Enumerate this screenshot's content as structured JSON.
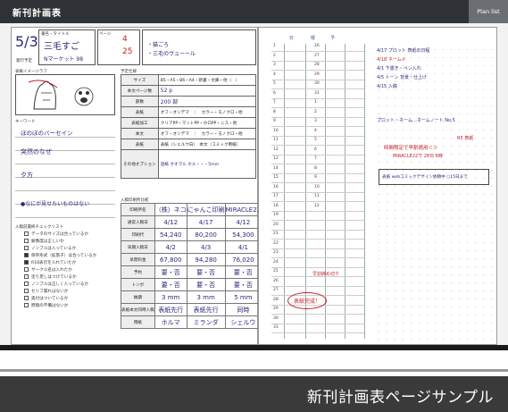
{
  "header": {
    "title": "新刊計画表",
    "tab": "Plan list"
  },
  "caption": "新刊計画表ページサンプル",
  "left_page": {
    "date": "5/3",
    "date_note": "発行予定",
    "title_label": "書名・タイトル",
    "title_value": "三毛すご",
    "pages_label": "ページ",
    "pages_value": "4",
    "pages_value2": "25",
    "shop_label": "Nマーケット 98",
    "memo_items": [
      "・猫ごろ",
      "・三毛のヴューール"
    ],
    "image_label": "表紙イメージラフ",
    "keyword_label": "キーワード",
    "keywords": [
      "ほのぼのバーセイン",
      "突然のなぜ",
      "夕方",
      "●なにが見せたいものはない"
    ],
    "checklist_label": "入稿前最終チェックリスト",
    "checklist": [
      "データのサイズは合っているか",
      "解像度は正しいか",
      "ノンブルは入っているか",
      "保存形式（拡張子）は合っているか",
      "R18表示を入れていたか",
      "サークル名は入れたか",
      "塗り足しはつけているか",
      "ノンブルは正しく入っているか",
      "セリフ漏れはないか",
      "奥付はついているか",
      "原稿の不備はないか"
    ],
    "spec_label": "予定仕様",
    "spec_rows": [
      {
        "h": "サイズ",
        "v": "B5・A5・B6・A4・新書・文庫・他（　）"
      },
      {
        "h": "本文ページ数",
        "v": "52 p"
      },
      {
        "h": "部数",
        "v": "200 部"
      },
      {
        "h": "表紙",
        "v": "オフ・オンデマ　｜　カラー・モノクロ・他"
      },
      {
        "h": "表紙加工",
        "v": "クリアPP・マットPP・ホロPP・ニス・他"
      },
      {
        "h": "本文",
        "v": "オフ・オンデマ　｜　カラー・モノクロ・他"
      },
      {
        "h": "表紙",
        "v": "表紙（シェルウ白）　本文（コミック用紙）"
      },
      {
        "h": "その他オプション",
        "v": "遊紙 オオマル ホル・・・5mm"
      }
    ],
    "compare_label": "入稿印刷所比較",
    "printers": [
      "（株）ネコ",
      "にゃんこ印刷",
      "MIRACLE22"
    ],
    "compare_rows": [
      {
        "h": "印刷所名",
        "v": [
          "（株）ネコ",
          "にゃんこ印刷",
          "MIRACLE22"
        ]
      },
      {
        "h": "通常入稿日",
        "v": [
          "4/12",
          "4/17",
          "4/12"
        ]
      },
      {
        "h": "印刷代",
        "v": [
          "54,240",
          "80,200",
          "54,300"
        ]
      },
      {
        "h": "早期入稿日",
        "v": [
          "4/2",
          "4/3",
          "4/1"
        ]
      },
      {
        "h": "早割料金",
        "v": [
          "67,800",
          "94,280",
          "76,020"
        ]
      },
      {
        "h": "予約",
        "v": [
          "要・否",
          "要・否",
          "要・否"
        ]
      },
      {
        "h": "トンボ",
        "v": [
          "要・否",
          "要・否",
          "要・否"
        ]
      },
      {
        "h": "納期",
        "v": [
          "3 mm",
          "3 mm",
          "5 mm"
        ]
      },
      {
        "h": "表紙本文同時入稿",
        "v": [
          "表紙先行",
          "表紙先行",
          "同時"
        ]
      },
      {
        "h": "用紙",
        "v": [
          "ホルマ",
          "ミランダ",
          "シェルウ"
        ]
      }
    ]
  },
  "right_page": {
    "col_headers": [
      "日",
      "曜",
      "予"
    ],
    "days": [
      "1",
      "2",
      "3",
      "4",
      "5",
      "6",
      "7",
      "8",
      "9",
      "10",
      "11",
      "12",
      "13",
      "14",
      "15",
      "16",
      "17",
      "18",
      "19",
      "20",
      "21",
      "22",
      "23",
      "24",
      "25",
      "26",
      "27",
      "28",
      "29",
      "30",
      "31"
    ],
    "second_col": [
      "26",
      "27",
      "28",
      "29",
      "30",
      "31",
      "1",
      "2",
      "3",
      "4",
      "5",
      "6",
      "7",
      "8",
      "9",
      "10",
      "11",
      "12"
    ],
    "notes": [
      "4/17 プロット 表紙の日程",
      "4/18 ネーム〆",
      "4/1 下書き・ペン入れ",
      "4/5 トーン 背景・仕上げ",
      "4/15 入稿"
    ],
    "schedule_note": "プロット・ネーム…ネームノート No.5",
    "warning": "時間限定で早割適用＜＞",
    "warning2": "MIRACLE22で 28日 6時",
    "side_note": "R5 表紙",
    "table_note": "表紙 webコミックデザイン依頼中 ○15日まで",
    "red_circle_note": "表紙完成！",
    "red_label": "早割締め切り"
  }
}
